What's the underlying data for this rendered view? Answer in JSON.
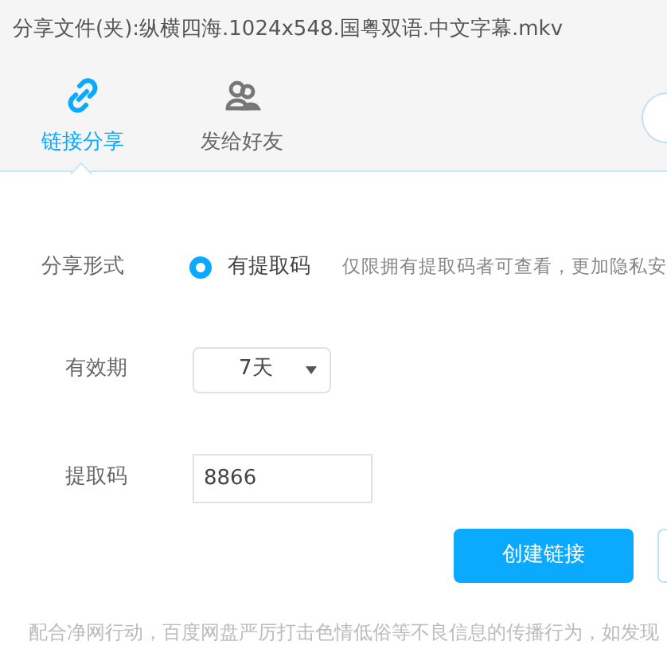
{
  "title": "分享文件(夹):纵横四海.1024x548.国粤双语.中文字幕.mkv",
  "tabs": [
    {
      "label": "链接分享",
      "selected": true
    },
    {
      "label": "发给好友",
      "selected": false
    }
  ],
  "form": [
    {
      "kind": "radio",
      "label": "分享形式",
      "option": "有提取码",
      "selected": true,
      "hint": "仅限拥有提取码者可查看，更加隐私安"
    },
    {
      "kind": "select",
      "label": "有效期",
      "value": "7天"
    },
    {
      "kind": "input",
      "label": "提取码",
      "value": "8866"
    }
  ],
  "primary_button": "创建链接",
  "notice": "配合净网行动，百度网盘严厉打击色情低俗等不良信息的传播行为，如发现"
}
